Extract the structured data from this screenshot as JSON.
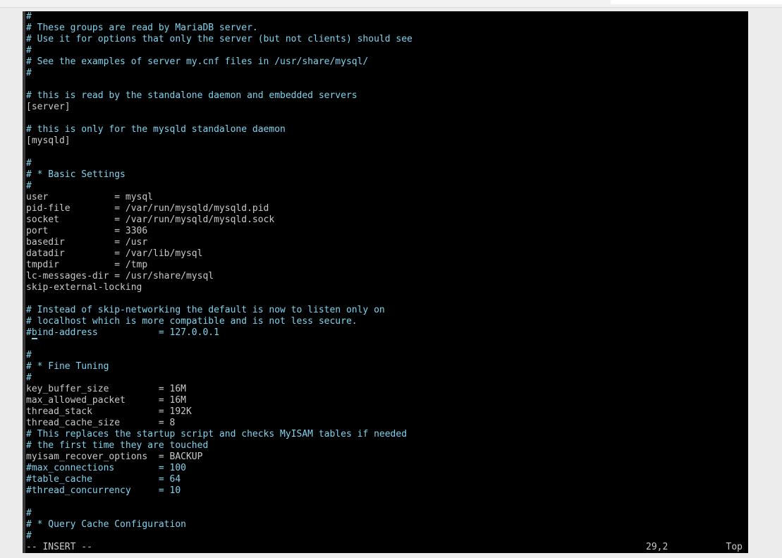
{
  "editor": {
    "lines": [
      {
        "text": "#",
        "kind": "comment"
      },
      {
        "text": "# These groups are read by MariaDB server.",
        "kind": "comment"
      },
      {
        "text": "# Use it for options that only the server (but not clients) should see",
        "kind": "comment"
      },
      {
        "text": "#",
        "kind": "comment"
      },
      {
        "text": "# See the examples of server my.cnf files in /usr/share/mysql/",
        "kind": "comment"
      },
      {
        "text": "#",
        "kind": "comment"
      },
      {
        "text": "",
        "kind": "blank"
      },
      {
        "text": "# this is read by the standalone daemon and embedded servers",
        "kind": "comment"
      },
      {
        "text": "[server]",
        "kind": "section"
      },
      {
        "text": "",
        "kind": "blank"
      },
      {
        "text": "# this is only for the mysqld standalone daemon",
        "kind": "comment"
      },
      {
        "text": "[mysqld]",
        "kind": "section"
      },
      {
        "text": "",
        "kind": "blank"
      },
      {
        "text": "#",
        "kind": "comment"
      },
      {
        "text": "# * Basic Settings",
        "kind": "comment"
      },
      {
        "text": "#",
        "kind": "comment"
      },
      {
        "text": "user            = mysql",
        "kind": "setting"
      },
      {
        "text": "pid-file        = /var/run/mysqld/mysqld.pid",
        "kind": "setting"
      },
      {
        "text": "socket          = /var/run/mysqld/mysqld.sock",
        "kind": "setting"
      },
      {
        "text": "port            = 3306",
        "kind": "setting"
      },
      {
        "text": "basedir         = /usr",
        "kind": "setting"
      },
      {
        "text": "datadir         = /var/lib/mysql",
        "kind": "setting"
      },
      {
        "text": "tmpdir          = /tmp",
        "kind": "setting"
      },
      {
        "text": "lc-messages-dir = /usr/share/mysql",
        "kind": "setting"
      },
      {
        "text": "skip-external-locking",
        "kind": "setting"
      },
      {
        "text": "",
        "kind": "blank"
      },
      {
        "text": "# Instead of skip-networking the default is now to listen only on",
        "kind": "comment"
      },
      {
        "text": "# localhost which is more compatible and is not less secure.",
        "kind": "comment"
      },
      {
        "text": "#bind-address           = 127.0.0.1",
        "kind": "comment",
        "cursor_col": 1
      },
      {
        "text": "",
        "kind": "blank"
      },
      {
        "text": "#",
        "kind": "comment"
      },
      {
        "text": "# * Fine Tuning",
        "kind": "comment"
      },
      {
        "text": "#",
        "kind": "comment"
      },
      {
        "text": "key_buffer_size         = 16M",
        "kind": "setting"
      },
      {
        "text": "max_allowed_packet      = 16M",
        "kind": "setting"
      },
      {
        "text": "thread_stack            = 192K",
        "kind": "setting"
      },
      {
        "text": "thread_cache_size       = 8",
        "kind": "setting"
      },
      {
        "text": "# This replaces the startup script and checks MyISAM tables if needed",
        "kind": "comment"
      },
      {
        "text": "# the first time they are touched",
        "kind": "comment"
      },
      {
        "text": "myisam_recover_options  = BACKUP",
        "kind": "setting"
      },
      {
        "text": "#max_connections        = 100",
        "kind": "comment"
      },
      {
        "text": "#table_cache            = 64",
        "kind": "comment"
      },
      {
        "text": "#thread_concurrency     = 10",
        "kind": "comment"
      },
      {
        "text": "",
        "kind": "blank"
      },
      {
        "text": "#",
        "kind": "comment"
      },
      {
        "text": "# * Query Cache Configuration",
        "kind": "comment"
      },
      {
        "text": "#",
        "kind": "comment"
      }
    ]
  },
  "status": {
    "mode": "-- INSERT --",
    "position": "29,2",
    "scroll": "Top"
  },
  "colors": {
    "comment": "#7fd4f0",
    "text": "#c9c9c9",
    "background": "#000000"
  }
}
